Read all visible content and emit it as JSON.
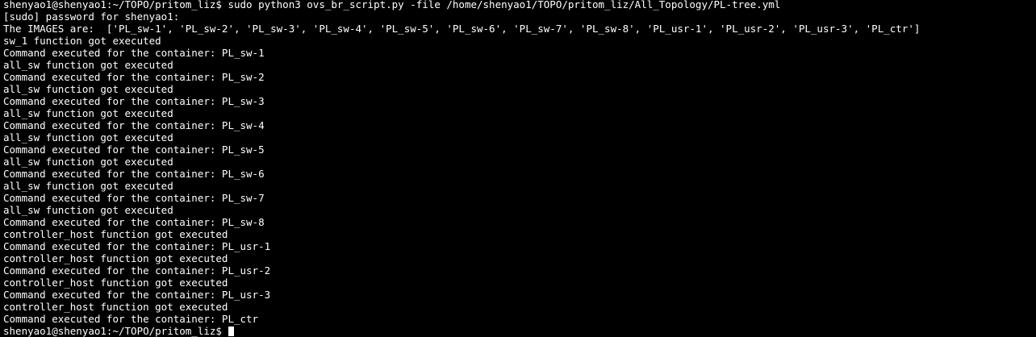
{
  "terminal": {
    "colors": {
      "background": "#000000",
      "foreground": "#ffffff"
    },
    "lines": [
      "shenyao1@shenyao1:~/TOPO/pritom_liz$ sudo python3 ovs_br_script.py -file /home/shenyao1/TOPO/pritom_liz/All_Topology/PL-tree.yml",
      "[sudo] password for shenyao1:",
      "The IMAGES are:  ['PL_sw-1', 'PL_sw-2', 'PL_sw-3', 'PL_sw-4', 'PL_sw-5', 'PL_sw-6', 'PL_sw-7', 'PL_sw-8', 'PL_usr-1', 'PL_usr-2', 'PL_usr-3', 'PL_ctr']",
      "sw_1 function got executed",
      "Command executed for the container: PL_sw-1",
      "all_sw function got executed",
      "Command executed for the container: PL_sw-2",
      "all_sw function got executed",
      "Command executed for the container: PL_sw-3",
      "all_sw function got executed",
      "Command executed for the container: PL_sw-4",
      "all_sw function got executed",
      "Command executed for the container: PL_sw-5",
      "all_sw function got executed",
      "Command executed for the container: PL_sw-6",
      "all_sw function got executed",
      "Command executed for the container: PL_sw-7",
      "all_sw function got executed",
      "Command executed for the container: PL_sw-8",
      "controller_host function got executed",
      "Command executed for the container: PL_usr-1",
      "controller_host function got executed",
      "Command executed for the container: PL_usr-2",
      "controller_host function got executed",
      "Command executed for the container: PL_usr-3",
      "controller_host function got executed",
      "Command executed for the container: PL_ctr"
    ],
    "prompt": "shenyao1@shenyao1:~/TOPO/pritom_liz$ "
  }
}
